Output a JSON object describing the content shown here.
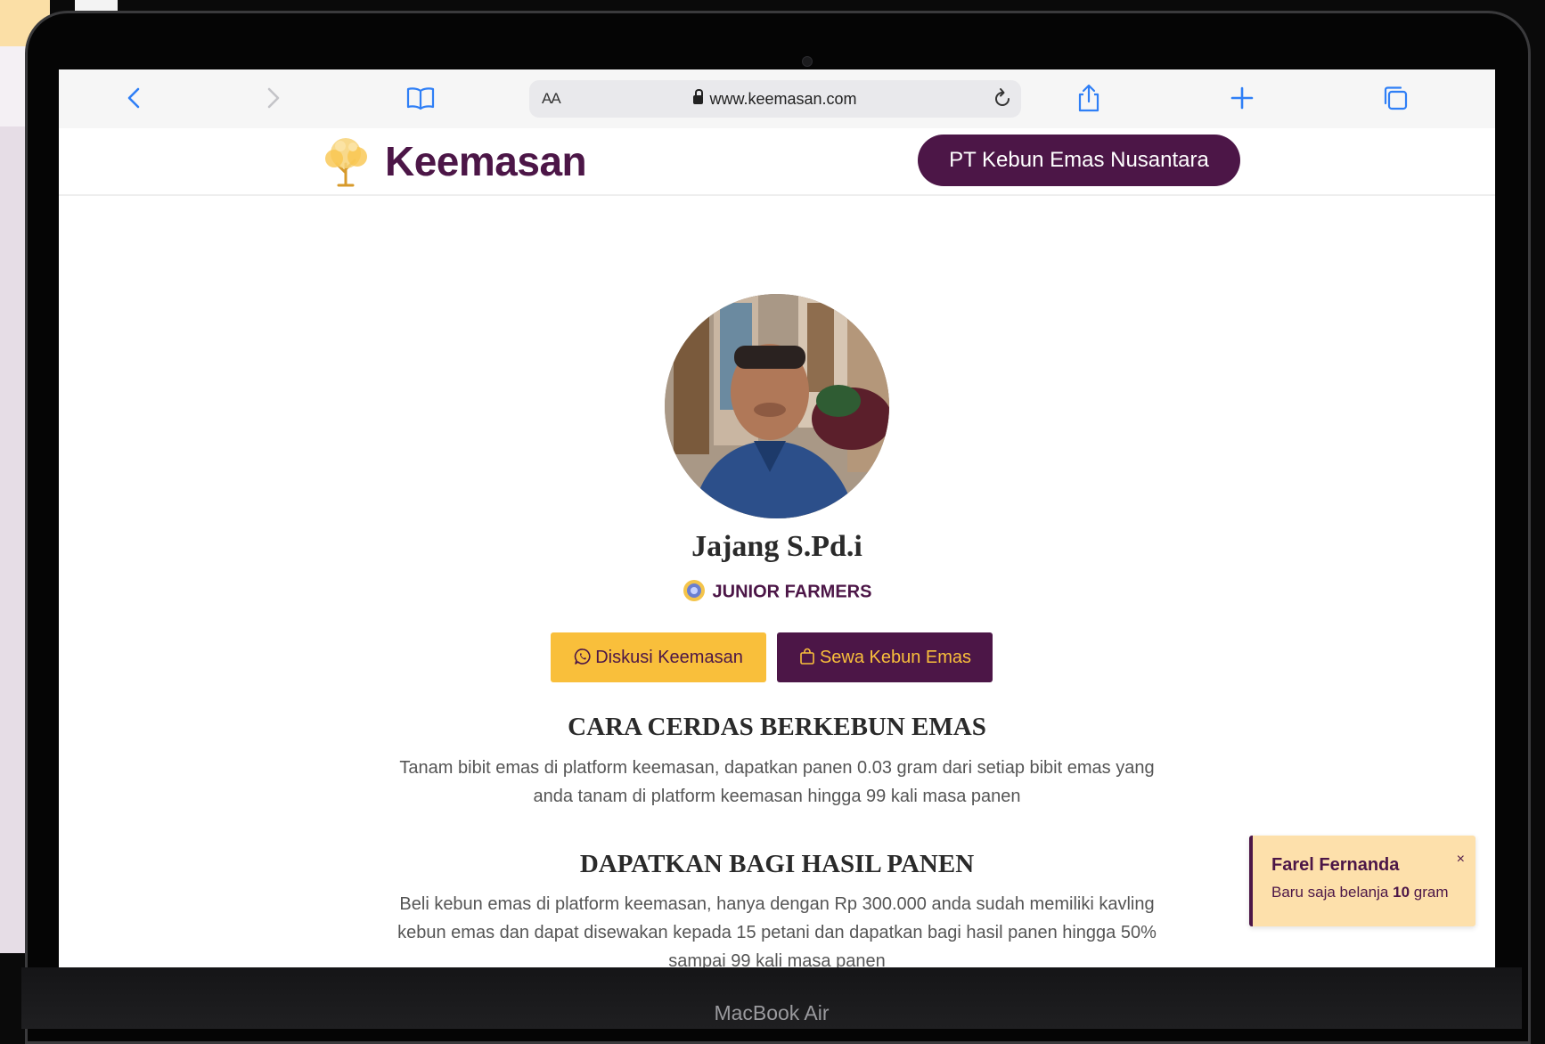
{
  "browser": {
    "url": "www.keemasan.com",
    "text_size_label": "AA",
    "icons": [
      "back-icon",
      "forward-icon",
      "bookmarks-icon",
      "lock-icon",
      "reload-icon",
      "share-icon",
      "new-tab-icon",
      "tabs-icon"
    ]
  },
  "site": {
    "logo_text": "Keemasan",
    "company_button": "PT Kebun Emas Nusantara"
  },
  "profile": {
    "name": "Jajang S.Pd.i",
    "rank": "JUNIOR FARMERS"
  },
  "actions": {
    "discuss_label": "Diskusi Keemasan",
    "rent_label": "Sewa Kebun Emas"
  },
  "sections": [
    {
      "title": "CARA CERDAS BERKEBUN EMAS",
      "lines": [
        "Tanam bibit emas di platform keemasan, dapatkan panen 0.03 gram dari setiap bibit emas yang",
        "anda tanam di platform keemasan hingga 99 kali masa panen"
      ]
    },
    {
      "title": "DAPATKAN BAGI HASIL PANEN",
      "lines": [
        "Beli kebun emas di platform keemasan, hanya dengan Rp 300.000 anda sudah memiliki kavling",
        "kebun emas dan dapat disewakan kepada 15 petani dan dapatkan bagi hasil panen hingga 50%",
        "sampai 99 kali masa panen"
      ]
    }
  ],
  "toast": {
    "name": "Farel Fernanda",
    "msg_prefix": "Baru saja belanja",
    "msg_amount": "10",
    "msg_unit": "gram",
    "close": "×"
  },
  "device": {
    "label": "MacBook Air"
  },
  "colors": {
    "brand_purple": "#4c1647",
    "brand_gold": "#f9bf3b",
    "toast_bg": "#fde0ab",
    "safari_blue": "#2f7ff6"
  }
}
